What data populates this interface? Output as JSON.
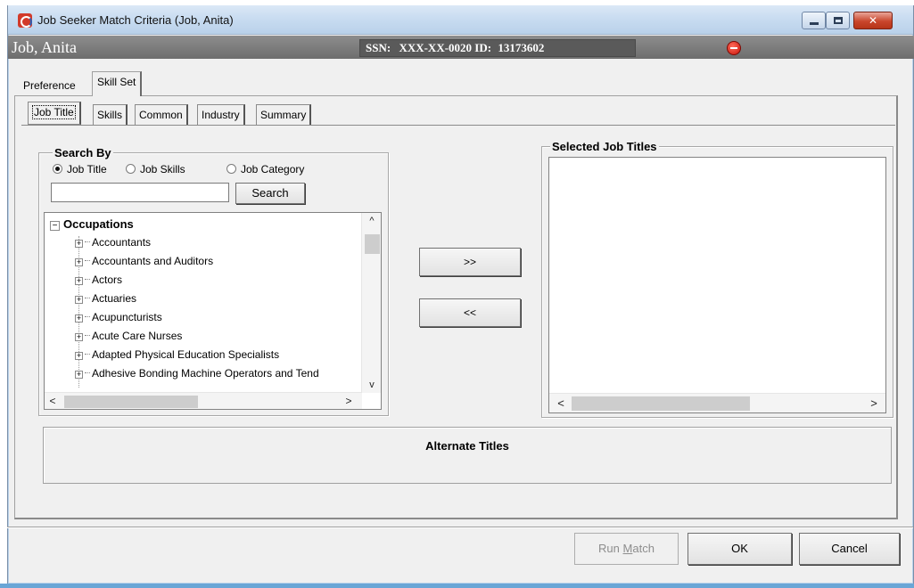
{
  "window": {
    "title": "Job Seeker Match Criteria (Job, Anita)",
    "controls": {
      "minimize": "–",
      "maximize": "□",
      "close": "✕"
    }
  },
  "header": {
    "person_name": "Job, Anita",
    "ssn_label": "SSN:",
    "ssn_value": "XXX-XX-0020",
    "id_label": "ID:",
    "id_value": "13173602"
  },
  "outer_tabs": [
    {
      "label": "Preference"
    },
    {
      "label": "Skill Set"
    }
  ],
  "inner_tabs": [
    {
      "label": "Job Title"
    },
    {
      "label": "Skills"
    },
    {
      "label": "Common"
    },
    {
      "label": "Industry"
    },
    {
      "label": "Summary"
    }
  ],
  "search": {
    "legend": "Search By",
    "options": [
      {
        "label": "Job Title",
        "checked": true
      },
      {
        "label": "Job Skills",
        "checked": false
      },
      {
        "label": "Job Category",
        "checked": false
      }
    ],
    "input_value": "",
    "button_label": "Search"
  },
  "tree": {
    "root_label": "Occupations",
    "root_expander": "−",
    "item_expander": "+",
    "items": [
      "Accountants",
      "Accountants and Auditors",
      "Actors",
      "Actuaries",
      "Acupuncturists",
      "Acute Care Nurses",
      "Adapted Physical Education Specialists",
      "Adhesive Bonding Machine Operators and Tend"
    ],
    "scroll_up": "^",
    "scroll_down": "v",
    "scroll_left": "<",
    "scroll_right": ">"
  },
  "move_buttons": {
    "add": ">>",
    "remove": "<<"
  },
  "selected": {
    "legend": "Selected Job Titles",
    "scroll_left": "<",
    "scroll_right": ">"
  },
  "alternate": {
    "label": "Alternate Titles"
  },
  "footer": {
    "run_match_prefix": "Run ",
    "run_match_underlined": "M",
    "run_match_suffix": "atch",
    "ok_label": "OK",
    "cancel_label": "Cancel"
  },
  "colors": {
    "accent": "#b9d1ea",
    "header_band": "#7a7a7a",
    "close_button": "#c9462c"
  }
}
